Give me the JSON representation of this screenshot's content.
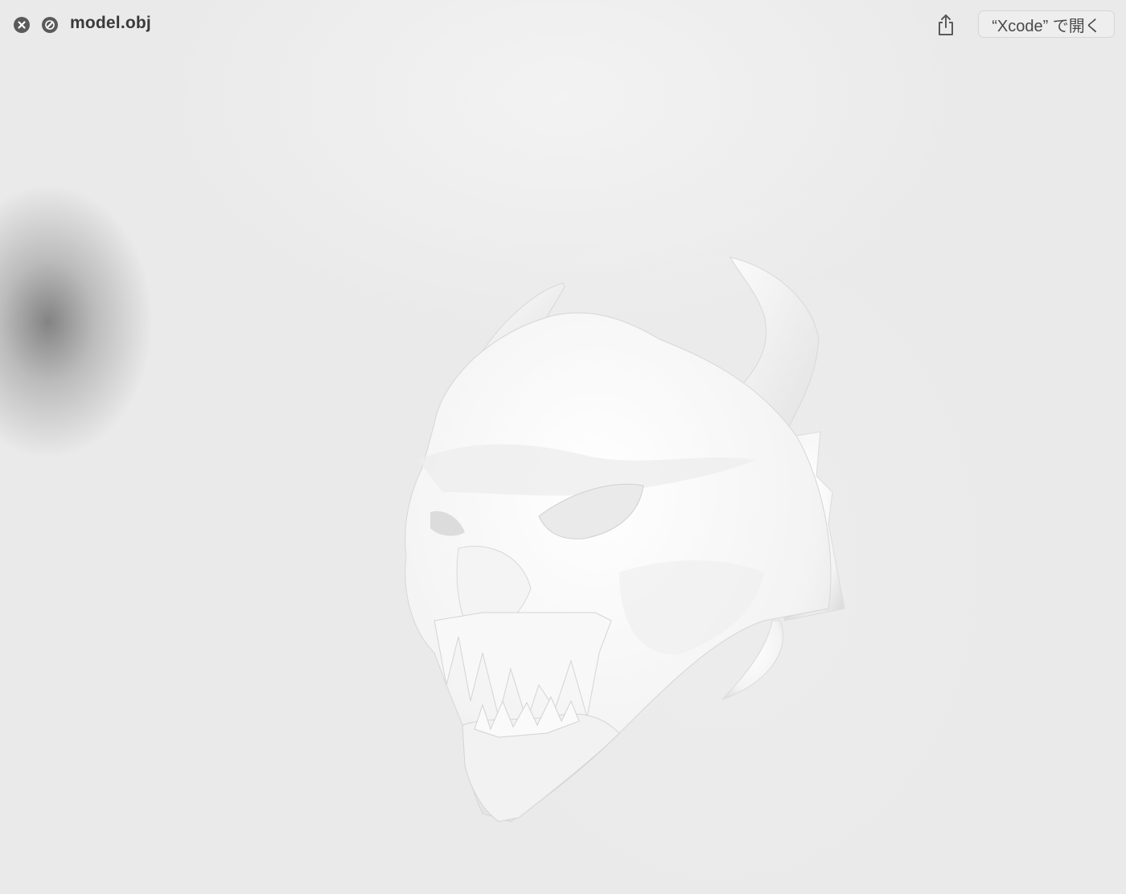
{
  "window": {
    "title": "model.obj"
  },
  "toolbar": {
    "close_icon": "close-icon",
    "pin_icon": "pin-icon",
    "share_icon": "share-icon",
    "open_label": "“Xcode” で開く"
  },
  "viewport": {
    "model_description_icon": "3d-model-preview",
    "background_color": "#eaeaea",
    "model_color": "#f7f7f7"
  }
}
